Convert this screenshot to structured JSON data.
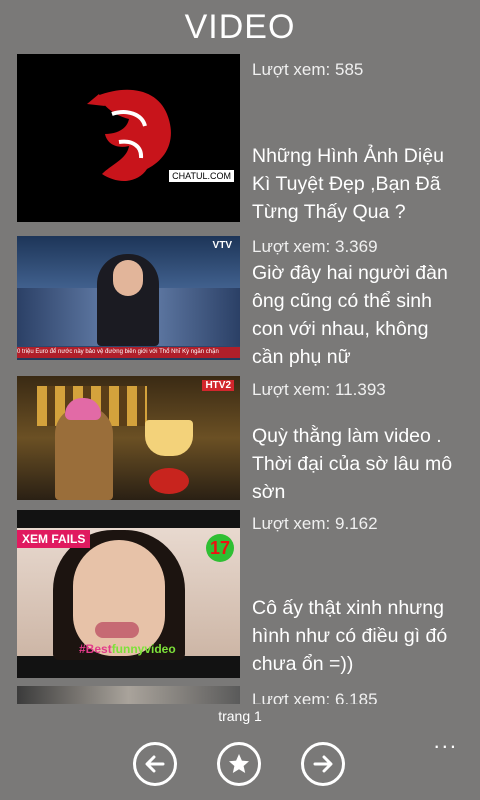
{
  "header": {
    "title": "VIDEO"
  },
  "videos": [
    {
      "views": "Lượt xem: 585",
      "title": "Những Hình Ảnh Diệu Kì Tuyệt Đẹp ,Bạn Đã Từng Thấy Qua ?",
      "thumb_watermark": "CHATUL.COM"
    },
    {
      "views": "Lượt xem: 3.369",
      "title": "Giờ đây hai người đàn ông cũng có thể sinh con với nhau, không cần phụ nữ",
      "thumb_channel": "VTV",
      "thumb_ticker": "0 triệu Euro để nước này bảo vệ đường biên giới với Thổ Nhĩ Kỳ ngăn chặn"
    },
    {
      "views": "Lượt xem: 11.393",
      "title": "Quỳ thằng làm video . Thời đại của sờ lâu mô sờn",
      "thumb_channel": "HTV2"
    },
    {
      "views": "Lượt xem: 9.162",
      "title": "Cô ấy thật xinh nhưng hình như có điều gì đó chưa ổn =))",
      "thumb_tag": "XEM FAILS",
      "thumb_number": "17",
      "thumb_caption_a": "#Best",
      "thumb_caption_b": "funnyvideo"
    },
    {
      "views": "Lượt xem: 6.185",
      "title": ""
    }
  ],
  "footer": {
    "page_label": "trang 1",
    "more": "..."
  }
}
